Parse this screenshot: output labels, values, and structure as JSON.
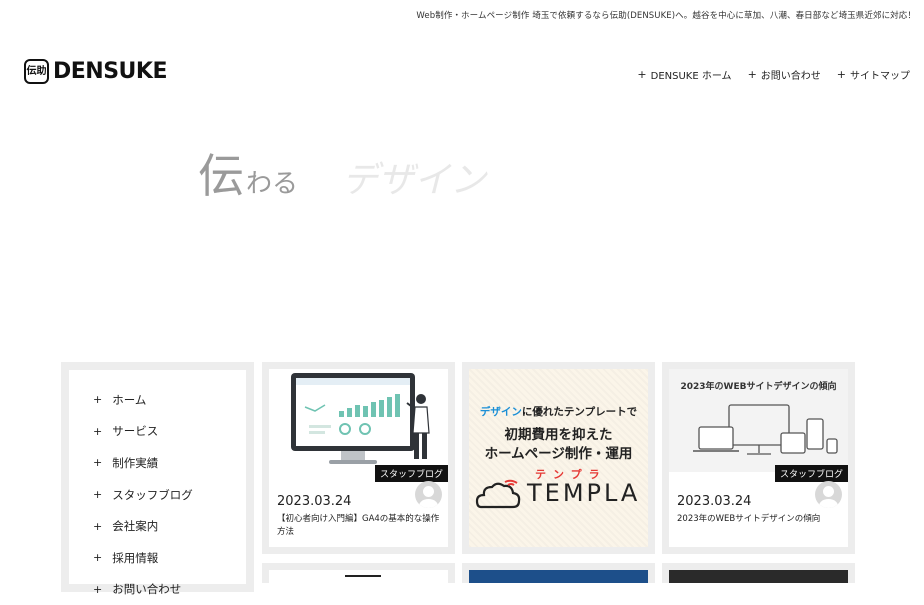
{
  "header": {
    "tagline": "Web制作・ホームページ制作 埼玉で依頼するなら伝助(DENSUKE)へ。越谷を中心に草加、八潮、春日部など埼玉県近郊に対応！",
    "logo_mark": "伝助",
    "logo_text": "DENSUKE"
  },
  "nav": [
    {
      "label": "DENSUKE ホーム"
    },
    {
      "label": "お問い合わせ"
    },
    {
      "label": "サイトマップ"
    }
  ],
  "hero": {
    "word1": "伝",
    "word2": "わる",
    "word3": "デザイン"
  },
  "sidebar": {
    "items": [
      {
        "label": "ホーム"
      },
      {
        "label": "サービス"
      },
      {
        "label": "制作実績"
      },
      {
        "label": "スタッフブログ"
      },
      {
        "label": "会社案内"
      },
      {
        "label": "採用情報"
      },
      {
        "label": "お問い合わせ"
      }
    ]
  },
  "cards": [
    {
      "badge": "スタッフブログ",
      "date": "2023.03.24",
      "title": "【初心者向け入門編】GA4の基本的な操作方法"
    },
    {
      "templa_line1_blue": "デザイン",
      "templa_line1_rest": "に優れたテンプレートで",
      "templa_line2": "初期費用を抑えた",
      "templa_line3": "ホームページ制作・運用",
      "templa_kana": "テンプラ",
      "templa_word": "TEMPLA"
    },
    {
      "thumb_heading": "2023年のWEBサイトデザインの傾向",
      "badge": "スタッフブログ",
      "date": "2023.03.24",
      "title": "2023年のWEBサイトデザインの傾向"
    }
  ],
  "colors": {
    "accent_blue": "#1b8fd6",
    "accent_red": "#e53935",
    "panel_gray": "#ededed"
  }
}
